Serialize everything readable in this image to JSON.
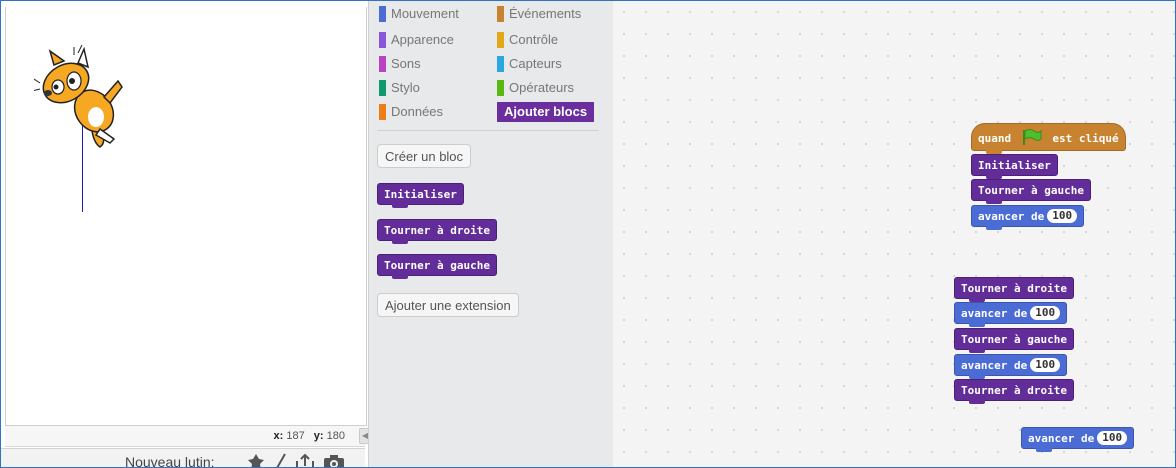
{
  "stage": {
    "coords": {
      "x_label": "x:",
      "x_value": "187",
      "y_label": "y:",
      "y_value": "180"
    },
    "new_sprite_label": "Nouveau lutin:",
    "new_sprite_icons": [
      "library-sprite-icon",
      "paint-brush-icon",
      "upload-icon",
      "camera-icon"
    ]
  },
  "palette": {
    "categories": [
      {
        "label": "Mouvement",
        "color": "#4a6cd4"
      },
      {
        "label": "Événements",
        "color": "#c88330"
      },
      {
        "label": "Apparence",
        "color": "#8a55d7"
      },
      {
        "label": "Contrôle",
        "color": "#e1a91a"
      },
      {
        "label": "Sons",
        "color": "#bb42c3"
      },
      {
        "label": "Capteurs",
        "color": "#2ca5e2"
      },
      {
        "label": "Stylo",
        "color": "#0e9a6c"
      },
      {
        "label": "Opérateurs",
        "color": "#5cb712"
      },
      {
        "label": "Données",
        "color": "#ee7d16"
      },
      {
        "label": "Ajouter blocs",
        "color": "#632d99"
      }
    ],
    "make_block_button": "Créer un bloc",
    "custom_blocks": [
      "Initialiser",
      "Tourner à droite",
      "Tourner à gauche"
    ],
    "add_extension_button": "Ajouter une extension"
  },
  "scripts": {
    "script1": {
      "hat_when": "quand",
      "hat_clicked": "est cliqué",
      "blocks": [
        {
          "label": "Initialiser"
        },
        {
          "label": "Tourner à gauche"
        },
        {
          "label": "avancer de",
          "value": "100"
        }
      ]
    },
    "script2": {
      "blocks": [
        {
          "label": "Tourner à droite"
        },
        {
          "label": "avancer de",
          "value": "100"
        },
        {
          "label": "Tourner à gauche"
        },
        {
          "label": "avancer de",
          "value": "100"
        },
        {
          "label": "Tourner à droite"
        }
      ]
    },
    "script3": {
      "blocks": [
        {
          "label": "avancer de",
          "value": "100"
        }
      ]
    }
  },
  "colors": {
    "purple_block": "#632d99",
    "blue_block": "#4a6cd4",
    "event_block": "#c88330",
    "green_flag": "#4cbf2d",
    "pen_line": "#1b1bb8"
  }
}
